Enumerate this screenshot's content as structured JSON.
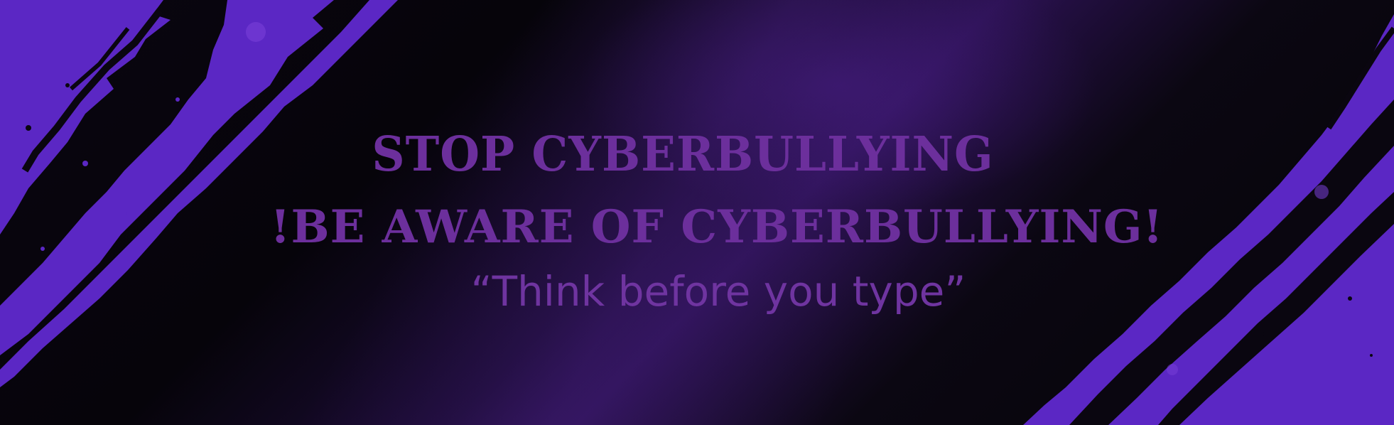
{
  "banner": {
    "headline_1": "STOP CYBERBULLYING",
    "headline_2": "!BE AWARE OF CYBERBULLYING!",
    "tagline": "“Think before you type”"
  },
  "colors": {
    "background": "#050308",
    "accent_purple": "#5b27c4",
    "text_purple": "#6c2f9c"
  },
  "decorations": [
    "grunge-brush-stroke-left",
    "grunge-brush-stroke-right"
  ]
}
